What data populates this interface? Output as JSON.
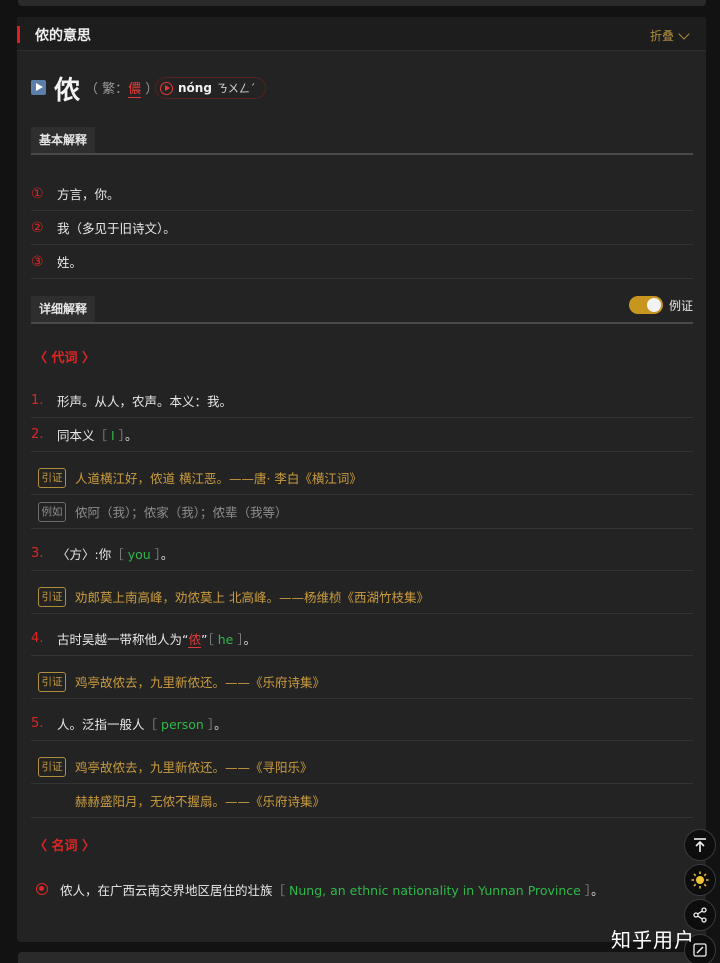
{
  "header": {
    "title": "侬的意思",
    "collapse_label": "折叠"
  },
  "entry": {
    "character": "侬",
    "traditional_prefix": "（ 繁：",
    "traditional_char": "儂",
    "traditional_suffix": " ）",
    "pinyin": "nóng",
    "zhuyin": "ㄋㄨㄥˊ"
  },
  "basic": {
    "tab_label": "基本解释",
    "items": [
      {
        "num": "①",
        "text": "方言，你。"
      },
      {
        "num": "②",
        "text": "我（多见于旧诗文）。"
      },
      {
        "num": "③",
        "text": "姓。"
      }
    ]
  },
  "detailed": {
    "tab_label": "详细解释",
    "toggle_label": "例证",
    "pronoun_label": "〈 代词 〉",
    "noun_label": "〈 名词 〉",
    "defs": [
      {
        "num": "1.",
        "text": "形声。从人，农声。本义：我。"
      },
      {
        "num": "2.",
        "text_before": "同本义",
        "open": "［",
        "en": " I ",
        "close": "］",
        "text_after": "。"
      },
      {
        "num": "3.",
        "text_before": "〈方〉:你",
        "open": "［",
        "en": " you ",
        "close": "］",
        "text_after": "。"
      },
      {
        "num": "4.",
        "text_before": "古时吴越一带称他人为“",
        "marked": "侬",
        "text_mid": "”",
        "open": "［",
        "en": " he ",
        "close": "］",
        "text_after": "。"
      },
      {
        "num": "5.",
        "text_before": "人。泛指一般人",
        "open": "［",
        "en": " person ",
        "close": "］",
        "text_after": "。"
      }
    ],
    "quotes": [
      {
        "tag": "引证",
        "text": "人道横江好，侬道 横江恶。——唐· 李白《横江词》"
      },
      {
        "tag": "例如",
        "text": "侬阿（我）；侬家（我）；侬辈（我等）"
      },
      {
        "tag": "引证",
        "text": "劝郎莫上南高峰，劝侬莫上 北高峰。——杨维桢《西湖竹枝集》"
      },
      {
        "tag": "引证",
        "text": "鸡亭故侬去，九里新侬还。——《乐府诗集》"
      },
      {
        "tag": "引证",
        "text": "鸡亭故侬去，九里新侬还。——《寻阳乐》"
      },
      {
        "tag": "",
        "text": "赫赫盛阳月，无侬不握扇。——《乐府诗集》"
      }
    ],
    "noun_def": {
      "text_before": "侬人，在广西云南交界地区居住的壮族",
      "open": "［",
      "en": " Nung, an ethnic nationality in Yunnan Province ",
      "close": "］",
      "text_after": "。"
    }
  },
  "fabs": {
    "top": "top-icon",
    "theme": "sun-icon",
    "share": "share-icon",
    "edit": "edit-icon"
  },
  "watermark": "知乎用户",
  "colors": {
    "accent_red": "#e02525",
    "gold": "#c99b3e",
    "english_green": "#2fb84a"
  }
}
